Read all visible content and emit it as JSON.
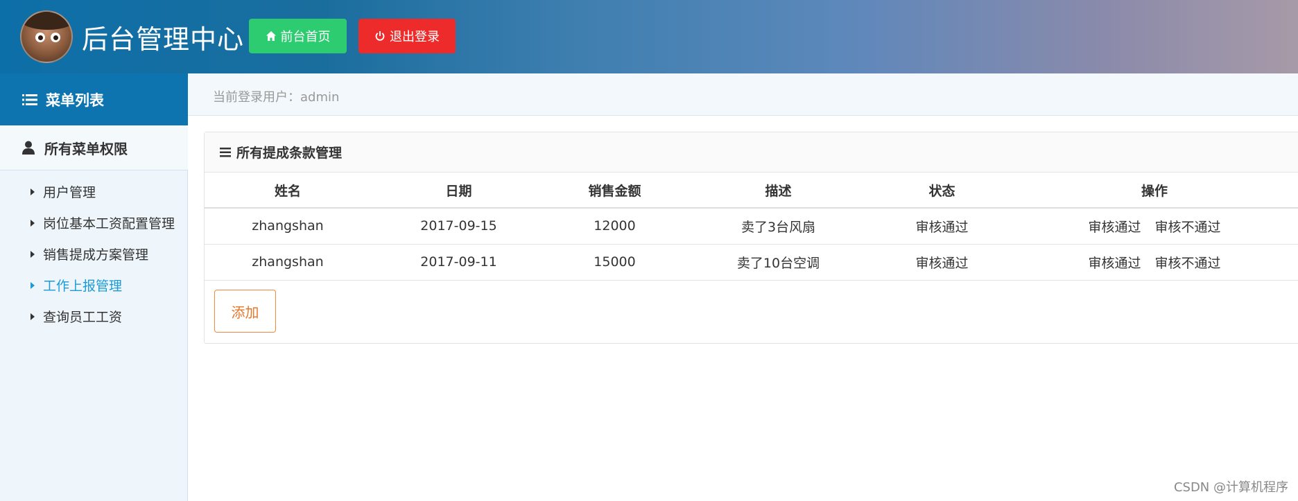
{
  "header": {
    "title": "后台管理中心",
    "home_label": "前台首页",
    "logout_label": "退出登录"
  },
  "sidebar": {
    "menu_title": "菜单列表",
    "group_label": "所有菜单权限",
    "items": [
      {
        "label": "用户管理"
      },
      {
        "label": "岗位基本工资配置管理"
      },
      {
        "label": "销售提成方案管理"
      },
      {
        "label": "工作上报管理"
      },
      {
        "label": "查询员工工资"
      }
    ]
  },
  "main": {
    "current_user_text": "当前登录用户：admin",
    "panel_title": "所有提成条款管理",
    "table": {
      "headers": [
        "姓名",
        "日期",
        "销售金额",
        "描述",
        "状态",
        "操作"
      ],
      "rows": [
        {
          "name": "zhangshan",
          "date": "2017-09-15",
          "amount": "12000",
          "desc": "卖了3台风扇",
          "status": "审核通过",
          "approve": "审核通过",
          "reject": "审核不通过"
        },
        {
          "name": "zhangshan",
          "date": "2017-09-11",
          "amount": "15000",
          "desc": "卖了10台空调",
          "status": "审核通过",
          "approve": "审核通过",
          "reject": "审核不通过"
        }
      ]
    },
    "add_label": "添加"
  },
  "watermark": "CSDN @计算机程序",
  "colors": {
    "home_button": "#2ecc71",
    "logout_button": "#ee2b2b",
    "active_menu": "#1a9ad6",
    "add_button": "#e8762a"
  }
}
